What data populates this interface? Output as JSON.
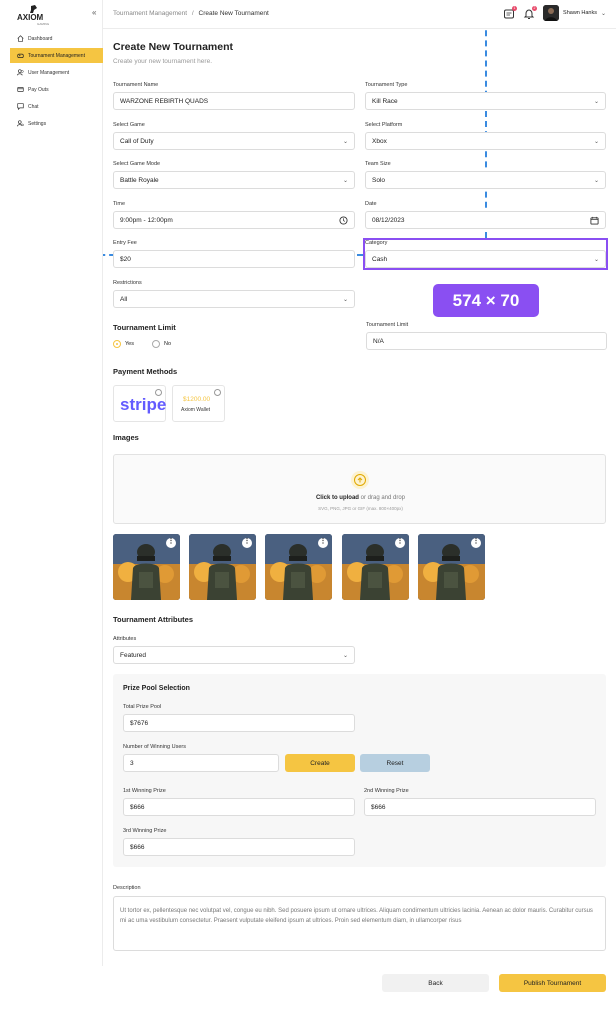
{
  "app": {
    "logo_text": "AXIOM",
    "logo_sub": "GAMING"
  },
  "sidebar": {
    "items": [
      {
        "label": "Dashboard",
        "icon": "home-icon"
      },
      {
        "label": "Tournament Management",
        "icon": "gamepad-icon",
        "active": true
      },
      {
        "label": "User Management",
        "icon": "users-icon"
      },
      {
        "label": "Pay Outs",
        "icon": "card-icon"
      },
      {
        "label": "Chat",
        "icon": "chat-icon"
      },
      {
        "label": "Settings",
        "icon": "gear-icon"
      }
    ]
  },
  "header": {
    "breadcrumb_parent": "Tournament Management",
    "breadcrumb_sep": "/",
    "breadcrumb_current": "Create New Tournament",
    "messages_badge": "1",
    "notifications_badge": "2",
    "user_name": "Shawn Hanks"
  },
  "page": {
    "title": "Create New Tournament",
    "subtitle": "Create your new tournament here."
  },
  "form": {
    "tournament_name": {
      "label": "Tournament Name",
      "value": "WARZONE REBIRTH QUADS"
    },
    "tournament_type": {
      "label": "Tournament Type",
      "value": "Kill Race"
    },
    "game": {
      "label": "Select Game",
      "value": "Call of Duty"
    },
    "platform": {
      "label": "Select Platform",
      "value": "Xbox"
    },
    "game_mode": {
      "label": "Select Game Mode",
      "value": "Battle Royale"
    },
    "team_size": {
      "label": "Team Size",
      "value": "Solo"
    },
    "time": {
      "label": "Time",
      "value": "9:00pm - 12:00pm"
    },
    "date": {
      "label": "Date",
      "value": "08/12/2023"
    },
    "entry_fee": {
      "label": "Entry Fee",
      "value": "$20"
    },
    "category": {
      "label": "Category",
      "value": "Cash"
    },
    "restrictions": {
      "label": "Restrictions",
      "value": "All"
    },
    "limit_section": "Tournament Limit",
    "limit_yes": "Yes",
    "limit_no": "No",
    "limit_field": {
      "label": "Tournament Limit",
      "value": "N/A"
    },
    "payment_title": "Payment Methods",
    "stripe_label": "stripe",
    "wallet_amount": "$1200.00",
    "wallet_label": "Axiom Wallet",
    "images_title": "Images",
    "upload_link": "Click to upload",
    "upload_rest": "or drag and drop",
    "upload_hint": "SVG, PNG, JPG or GIF (max. 800×400px)",
    "attributes_title": "Tournament Attributes",
    "attributes": {
      "label": "Attributes",
      "value": "Featured"
    },
    "prize": {
      "title": "Prize Pool Selection",
      "total_label": "Total Prize Pool",
      "total_value": "$7676",
      "winners_label": "Number of Winning Users",
      "winners_value": "3",
      "create_label": "Create",
      "reset_label": "Reset",
      "first_label": "1st Winning Prize",
      "first_value": "$666",
      "second_label": "2nd Winning Prize",
      "second_value": "$666",
      "third_label": "3rd Winning Prize",
      "third_value": "$666"
    },
    "description": {
      "label": "Description",
      "value": "Ut tortor ex, pellentesque nec volutpat vel, congue eu nibh. Sed posuere ipsum ut ornare ultrices. Aliquam condimentum ultricies lacinia. Aenean ac dolor mauris. Curabitur cursus mi ac uma vestibulum consectetur. Praesent vulputate eleifend ipsum at ultrices. Proin sed elementum diam, in ullamcorper risus"
    }
  },
  "footer": {
    "back_label": "Back",
    "publish_label": "Publish Tournament"
  },
  "overlay": {
    "measure_label": "574 × 70"
  },
  "colors": {
    "accent": "#f5c542",
    "overlay": "#8a4ff2",
    "guide": "#3a8be0",
    "reset": "#b7cfe0",
    "stripe": "#635bff"
  }
}
